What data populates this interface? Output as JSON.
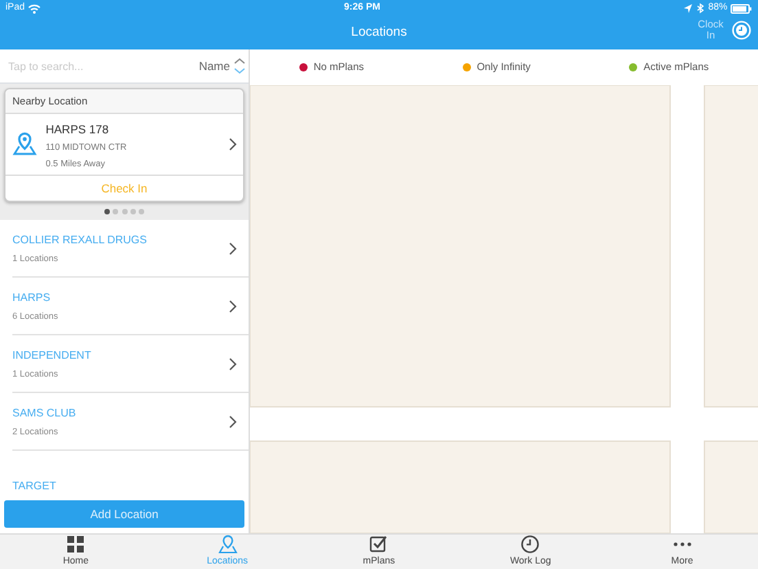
{
  "status_bar": {
    "device": "iPad",
    "time": "9:26 PM",
    "battery": "88%"
  },
  "nav_bar": {
    "title": "Locations",
    "action": "Clock In"
  },
  "search": {
    "placeholder": "Tap to search...",
    "sort": "Name"
  },
  "legend": [
    {
      "label": "No mPlans",
      "color": "#c8103c"
    },
    {
      "label": "Only Infinity",
      "color": "#f5a300"
    },
    {
      "label": "Active mPlans",
      "color": "#86bc2e"
    }
  ],
  "nearby": {
    "header": "Nearby Location",
    "name": "HARPS 178",
    "address": "110 MIDTOWN CTR",
    "distance": "0.5 Miles Away",
    "action": "Check In",
    "pages": [
      {
        "selected": true
      },
      {
        "selected": false
      },
      {
        "selected": false
      },
      {
        "selected": false
      },
      {
        "selected": false
      }
    ]
  },
  "groups": [
    {
      "name": "COLLIER REXALL DRUGS",
      "count": "1 Locations"
    },
    {
      "name": "HARPS",
      "count": "6 Locations"
    },
    {
      "name": "INDEPENDENT",
      "count": "1 Locations"
    },
    {
      "name": "SAMS CLUB",
      "count": "2 Locations"
    },
    {
      "name": "TARGET"
    }
  ],
  "add_button": "Add Location",
  "tabs": [
    {
      "label": "Home",
      "kind": "grid",
      "selected": false
    },
    {
      "label": "Locations",
      "kind": "pin",
      "selected": true
    },
    {
      "label": "mPlans",
      "kind": "check",
      "selected": false
    },
    {
      "label": "Work Log",
      "kind": "clock",
      "selected": false
    },
    {
      "label": "More",
      "kind": "dots",
      "selected": false
    }
  ]
}
